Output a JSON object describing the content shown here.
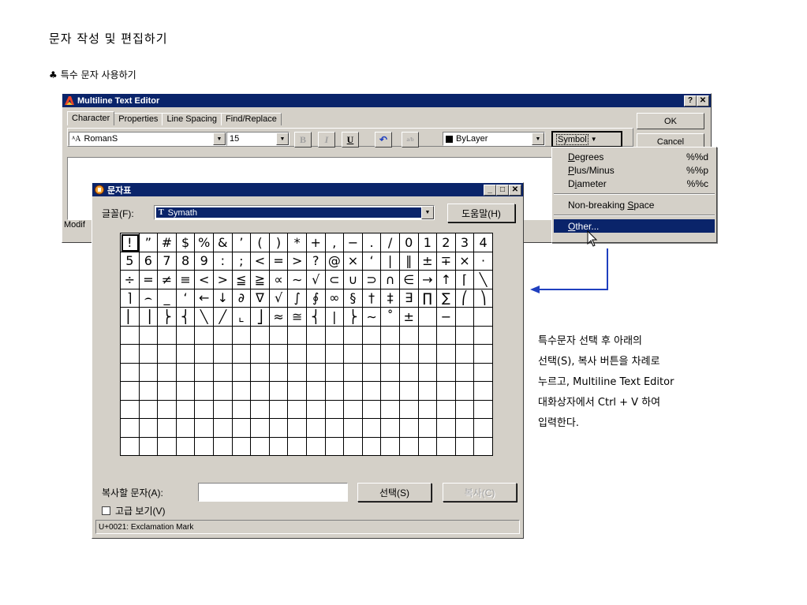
{
  "doc": {
    "title": "문자 작성 및 편집하기",
    "subtitle_bullet": "♣",
    "subtitle": "특수 문자 사용하기"
  },
  "mte": {
    "title": "Multiline Text Editor",
    "help_btn": "?",
    "close_btn": "✕",
    "tabs": [
      "Character",
      "Properties",
      "Line Spacing",
      "Find/Replace"
    ],
    "font_value": "RomanS",
    "height_value": "15",
    "bold": "B",
    "italic": "I",
    "underline": "U",
    "undo": "↶",
    "stack": "a/b",
    "color_value": "ByLayer",
    "symbol_label": "Symbol",
    "ok_label": "OK",
    "cancel_label": "Cancel",
    "status_text": "Modif"
  },
  "symbol_menu": {
    "items": [
      {
        "label": "Degrees",
        "u": "D",
        "rest": "egrees",
        "shortcut": "%%d"
      },
      {
        "label": "Plus/Minus",
        "u": "P",
        "rest": "lus/Minus",
        "shortcut": "%%p"
      },
      {
        "label": "Diameter",
        "pre": "D",
        "u": "i",
        "rest": "ameter",
        "shortcut": "%%c"
      }
    ],
    "nbsp_pre": "Non-breaking ",
    "nbsp_u": "S",
    "nbsp_rest": "pace",
    "other_u": "O",
    "other_rest": "ther..."
  },
  "charmap": {
    "title": "문자표",
    "font_label": "글꼴(F):",
    "font_value": "Symath",
    "font_prefix": "T",
    "help_label": "도움말(H)",
    "copy_label": "복사할 문자(A):",
    "copy_value": "",
    "select_label": "선택(S)",
    "copy_btn_label": "복사(C)",
    "advanced_label": "고급 보기(V)",
    "status": "U+0021: Exclamation Mark",
    "glyphs": [
      "!",
      "”",
      "#",
      "$",
      "%",
      "&",
      "’",
      "(",
      ")",
      "*",
      "+",
      ",",
      "−",
      ".",
      "/",
      "0",
      "1",
      "2",
      "3",
      "4",
      "5",
      "6",
      "7",
      "8",
      "9",
      ":",
      ";",
      "<",
      "=",
      ">",
      "?",
      "@",
      "×",
      "‘",
      "|",
      "‖",
      "±",
      "∓",
      "×",
      "·",
      "÷",
      "=",
      "≠",
      "≡",
      "<",
      ">",
      "≦",
      "≧",
      "∝",
      "∼",
      "√",
      "⊂",
      "∪",
      "⊃",
      "∩",
      "∈",
      "→",
      "↑",
      "⌈",
      "╲",
      "⌉",
      "⌢",
      "_",
      "‘",
      "←",
      "↓",
      "∂",
      "∇",
      "√",
      "∫",
      "∮",
      "∞",
      "§",
      "†",
      "‡",
      "∃",
      "∏",
      "∑",
      "⎛",
      "⎞",
      "⎢",
      "⎥",
      "⎬",
      "⎨",
      "╲",
      "╱",
      "⌞",
      "⎦",
      "≈",
      "≅",
      "⎨",
      "|",
      "⎬",
      "∼",
      "˚",
      "±",
      "",
      "−",
      "",
      ""
    ]
  },
  "note": {
    "lines": [
      "특수문자 선택 후 아래의",
      "선택(S), 복사 버튼을 차례로",
      "누르고, Multiline Text Editor",
      "대화상자에서 Ctrl + V 하여",
      "입력한다."
    ],
    "arrow_color": "#1f3fbf"
  }
}
